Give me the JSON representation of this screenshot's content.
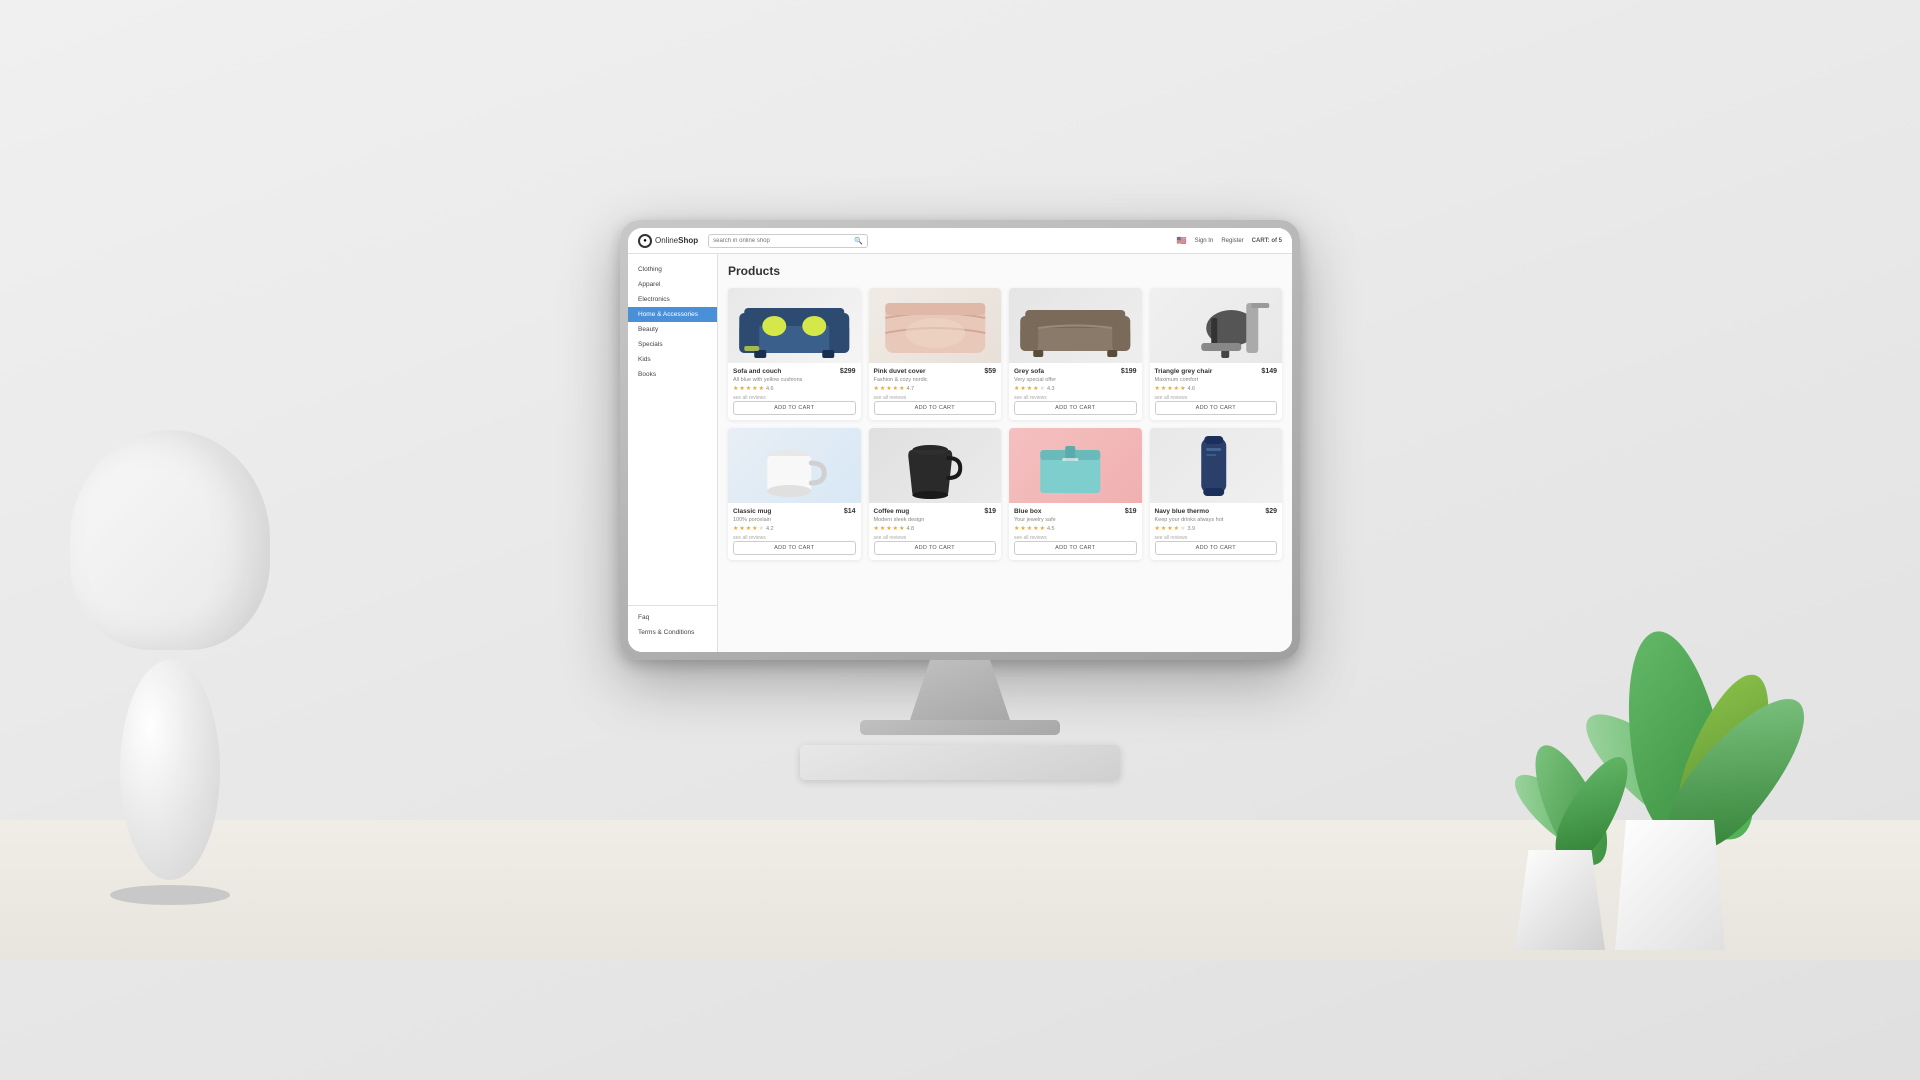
{
  "scene": {
    "background": "#e4e4e4"
  },
  "app": {
    "logo": {
      "text_online": "Online",
      "text_shop": "Shop",
      "icon": "●"
    },
    "search": {
      "placeholder": "search in online shop"
    },
    "header": {
      "login": "Sign In",
      "register": "Register",
      "cart": "CART: of 5"
    },
    "sidebar": {
      "items": [
        {
          "label": "Clothing",
          "active": false
        },
        {
          "label": "Apparel",
          "active": false
        },
        {
          "label": "Electronics",
          "active": false
        },
        {
          "label": "Home & Accessories",
          "active": true
        },
        {
          "label": "Beauty",
          "active": false
        },
        {
          "label": "Specials",
          "active": false
        },
        {
          "label": "Kids",
          "active": false
        },
        {
          "label": "Books",
          "active": false
        }
      ],
      "footer_items": [
        {
          "label": "Faq"
        },
        {
          "label": "Terms & Conditions"
        }
      ]
    },
    "page_title": "Products",
    "products": [
      {
        "id": "sofa-couch",
        "name": "Sofa and couch",
        "desc": "All blue with yellow cushions",
        "price": "$299",
        "rating": 4.6,
        "stars": [
          1,
          1,
          1,
          1,
          0.6
        ],
        "reviews": "see all reviews",
        "btn": "ADD TO CART",
        "img_color": "#3a5f8a",
        "bg": "#eeeeee"
      },
      {
        "id": "pink-duvet",
        "name": "Pink duvet cover",
        "desc": "Fashion & cozy nordic",
        "price": "$59",
        "rating": 4.7,
        "stars": [
          1,
          1,
          1,
          1,
          0.7
        ],
        "reviews": "see all reviews",
        "btn": "ADD TO CART",
        "img_color": "#e8d5c8",
        "bg": "#f5ede5"
      },
      {
        "id": "grey-sofa",
        "name": "Grey sofa",
        "desc": "Very special offer",
        "price": "$199",
        "rating": 4.3,
        "stars": [
          1,
          1,
          1,
          1,
          0.3
        ],
        "reviews": "see all reviews",
        "btn": "ADD TO CART",
        "img_color": "#8a7a6a",
        "bg": "#eeeeee"
      },
      {
        "id": "triangle-chair",
        "name": "Triangle grey chair",
        "desc": "Maximum comfort",
        "price": "$149",
        "rating": 4.6,
        "stars": [
          1,
          1,
          1,
          1,
          0.6
        ],
        "reviews": "see all reviews",
        "btn": "ADD TO CART",
        "img_color": "#555555",
        "bg": "#f5f5f5"
      },
      {
        "id": "classic-mug",
        "name": "Classic mug",
        "desc": "100% porcelain",
        "price": "$14",
        "rating": 4.2,
        "stars": [
          1,
          1,
          1,
          1,
          0.2
        ],
        "reviews": "see all reviews",
        "btn": "ADD TO CART",
        "img_color": "#ffffff",
        "bg": "#dde8f5"
      },
      {
        "id": "coffee-mug",
        "name": "Coffee mug",
        "desc": "Modern sleek design",
        "price": "$19",
        "rating": 4.8,
        "stars": [
          1,
          1,
          1,
          1,
          0.8
        ],
        "reviews": "see all reviews",
        "btn": "ADD TO CART",
        "img_color": "#2a2a2a",
        "bg": "#e8e8e8"
      },
      {
        "id": "blue-box",
        "name": "Blue box",
        "desc": "Your jewelry safe",
        "price": "$19",
        "rating": 4.5,
        "stars": [
          1,
          1,
          1,
          1,
          0.5
        ],
        "reviews": "see all reviews",
        "btn": "ADD TO CART",
        "img_color": "#7ecece",
        "bg": "#f5b0b0"
      },
      {
        "id": "navy-thermo",
        "name": "Navy blue thermo",
        "desc": "Keep your drinks always hot",
        "price": "$29",
        "rating": 3.9,
        "stars": [
          1,
          1,
          1,
          0.9,
          0
        ],
        "reviews": "see all reviews",
        "btn": "ADD TO CART",
        "img_color": "#2a3f6a",
        "bg": "#e8e8e8"
      }
    ]
  }
}
